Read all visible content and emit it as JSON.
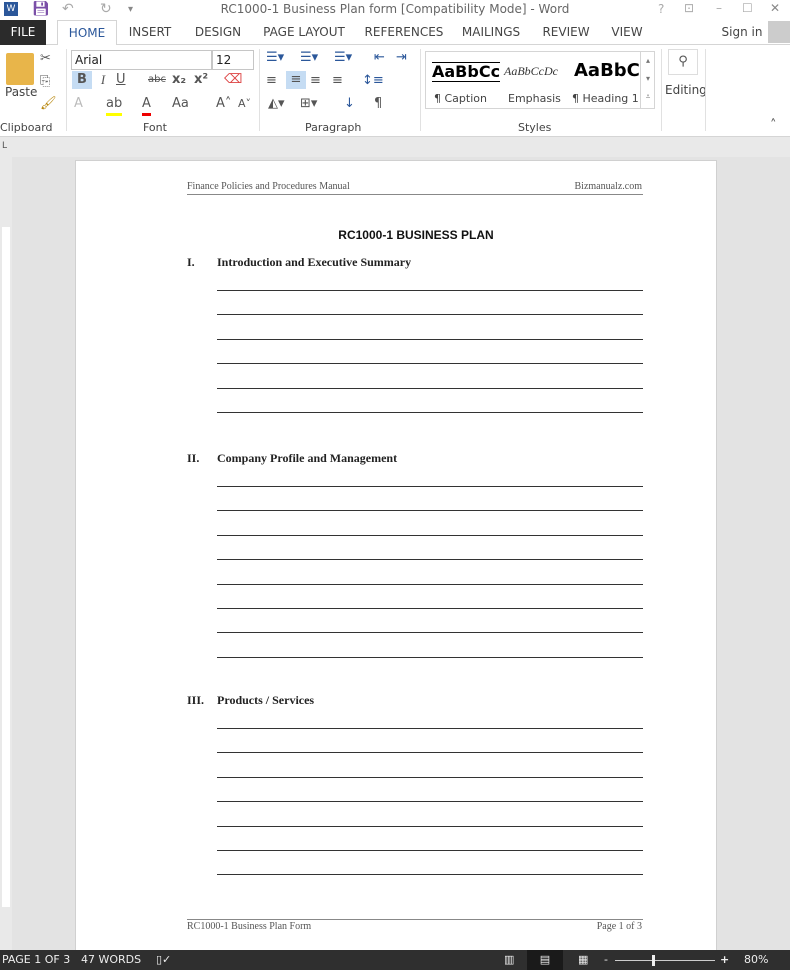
{
  "window": {
    "title": "RC1000-1 Business Plan form [Compatibility Mode] - Word",
    "help": "?",
    "restore_ribbon": "⊡",
    "minimize": "–",
    "maximize": "☐",
    "close": "✕"
  },
  "tabs": [
    {
      "label": "FILE"
    },
    {
      "label": "HOME"
    },
    {
      "label": "INSERT"
    },
    {
      "label": "DESIGN"
    },
    {
      "label": "PAGE LAYOUT"
    },
    {
      "label": "REFERENCES"
    },
    {
      "label": "MAILINGS"
    },
    {
      "label": "REVIEW"
    },
    {
      "label": "VIEW"
    }
  ],
  "sign_in": "Sign in",
  "ribbon": {
    "clipboard": {
      "label": "Clipboard",
      "paste": "Paste"
    },
    "font": {
      "label": "Font",
      "name": "Arial",
      "size": "12",
      "bold": "B",
      "italic": "I",
      "underline": "U",
      "strike": "abc",
      "subscript": "x₂",
      "superscript": "x²",
      "change_case": "Aa",
      "grow": "A˄",
      "shrink": "A˅"
    },
    "paragraph": {
      "label": "Paragraph",
      "pilcrow": "¶"
    },
    "styles": {
      "label": "Styles",
      "items": [
        {
          "preview": "AaBbCc",
          "name": "¶ Caption"
        },
        {
          "preview": "AaBbCcDc",
          "name": "Emphasis"
        },
        {
          "preview": "AaBbC",
          "name": "¶ Heading 1"
        }
      ]
    },
    "editing": {
      "label": "Editing"
    }
  },
  "document": {
    "header_left": "Finance Policies and Procedures Manual",
    "header_right": "Bizmanualz.com",
    "title": "RC1000-1 BUSINESS PLAN",
    "sections": [
      {
        "num": "I.",
        "title": "Introduction and Executive Summary",
        "line_count": 6
      },
      {
        "num": "II.",
        "title": "Company Profile and Management",
        "line_count": 8
      },
      {
        "num": "III.",
        "title": "Products / Services",
        "line_count": 7
      }
    ],
    "footer_left": "RC1000-1 Business Plan Form",
    "footer_right": "Page 1 of 3"
  },
  "status": {
    "page": "PAGE 1 OF 3",
    "words": "47 WORDS",
    "zoom": "80%",
    "zoom_minus": "-",
    "zoom_plus": "+"
  }
}
